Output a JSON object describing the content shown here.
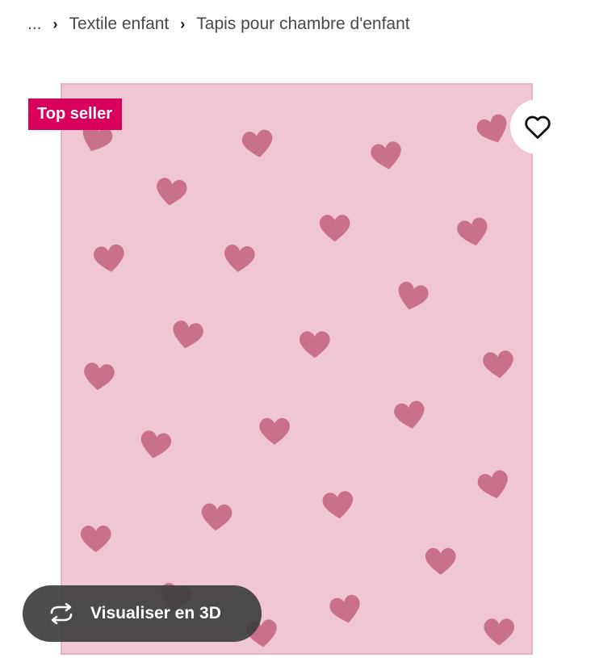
{
  "breadcrumb": {
    "items": [
      {
        "label": "..."
      },
      {
        "label": "Textile enfant"
      },
      {
        "label": "Tapis pour chambre d'enfant"
      }
    ]
  },
  "product": {
    "badge": "Top seller",
    "favorite_icon": "heart-outline-icon",
    "view_3d_label": "Visualiser en 3D",
    "view_3d_icon": "rotate-arrows-icon"
  },
  "colors": {
    "badge_bg": "#d8005a",
    "rug": "#f1c6d3",
    "heart": "#c9718b",
    "button_bg": "#3e3e3e"
  }
}
